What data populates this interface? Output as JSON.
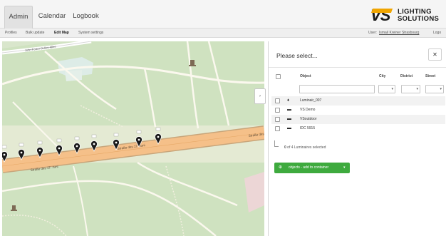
{
  "nav": {
    "tabs": [
      {
        "label": "Admin",
        "active": true
      },
      {
        "label": "Calendar",
        "active": false
      },
      {
        "label": "Logbook",
        "active": false
      }
    ]
  },
  "logo": {
    "mark": "VS",
    "line1": "LIGHTING",
    "line2": "SOLUTIONS"
  },
  "subnav": {
    "items": [
      {
        "label": "Profiles"
      },
      {
        "label": "Bulk update"
      },
      {
        "label": "Edit Map"
      },
      {
        "label": "System settings"
      }
    ],
    "user_label": "User:",
    "user_name": "Ismail Kreiner Strasbourg",
    "logout": "Logo"
  },
  "map": {
    "street_labels": [
      "John-Foster-Dulles-Allee",
      "Straße des 17. Juni",
      "Straße des 17. Juni",
      "Straße des 17. Juni"
    ],
    "marker_count": 10
  },
  "panel": {
    "title": "Please select...",
    "close_icon": "close-icon",
    "columns": [
      "Object",
      "City",
      "District",
      "Street"
    ],
    "rows": [
      {
        "icon": "luminaire-icon",
        "name": "Luminair_007"
      },
      {
        "icon": "cabinet-icon",
        "name": "VS Demo"
      },
      {
        "icon": "cabinet-icon",
        "name": "VSoutdoor"
      },
      {
        "icon": "cabinet-icon",
        "name": "IDC 5915"
      }
    ],
    "selected_count": "0",
    "selected_text": "of 4 Luminaires selected",
    "action_button": "objects - add to container",
    "action_caret": "▾"
  },
  "colors": {
    "accent_green": "#3eaa3e",
    "logo_orange": "#f0a500",
    "road_orange": "#f5c089"
  }
}
